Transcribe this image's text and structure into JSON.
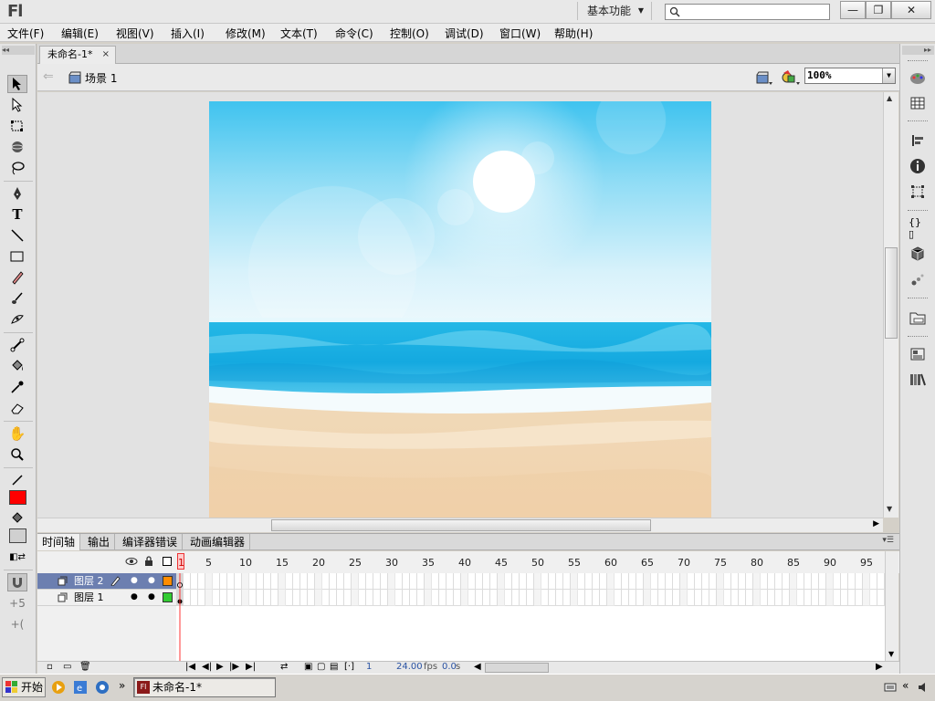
{
  "app": {
    "logo_text": "Fl",
    "workspace": "基本功能",
    "search_placeholder": "",
    "window_buttons": {
      "minimize": "—",
      "restore": "❐",
      "close": "✕"
    }
  },
  "menu": [
    "文件(F)",
    "编辑(E)",
    "视图(V)",
    "插入(I)",
    "修改(M)",
    "文本(T)",
    "命令(C)",
    "控制(O)",
    "调试(D)",
    "窗口(W)",
    "帮助(H)"
  ],
  "document": {
    "tab_title": "未命名-1*",
    "tab_close": "×",
    "scene_label": "场景 1",
    "zoom": "100%"
  },
  "colors": {
    "stroke_color": "#000000",
    "fill_color": "#ff0000",
    "layer2_color": "#ff8c00",
    "layer1_color": "#33cc33",
    "selected_layer_bg": "#6c7fb0",
    "playhead": "#ff3333"
  },
  "timeline": {
    "tabs": [
      "时间轴",
      "输出",
      "编译器错误",
      "动画编辑器"
    ],
    "frame_numbers": [
      "1",
      "5",
      "10",
      "15",
      "20",
      "25",
      "30",
      "35",
      "40",
      "45",
      "50",
      "55",
      "60",
      "65",
      "70",
      "75",
      "80",
      "85",
      "90",
      "95"
    ],
    "layers": [
      {
        "name": "图层 2",
        "selected": true
      },
      {
        "name": "图层 1",
        "selected": false
      }
    ],
    "current_frame": "1",
    "fps": "24.00",
    "fps_unit": "fps",
    "time": "0.0",
    "time_unit": "s"
  },
  "taskbar": {
    "start_label": "开始",
    "flash_task_label": "未命名-1*",
    "chevron": "»",
    "tray_chevron": "«"
  },
  "icons": {
    "tools": [
      "selection-tool-icon",
      "subselection-tool-icon",
      "free-transform-tool-icon",
      "3d-rotation-tool-icon",
      "lasso-tool-icon",
      "pen-tool-icon",
      "text-tool-icon",
      "line-tool-icon",
      "rectangle-tool-icon",
      "pencil-tool-icon",
      "brush-tool-icon",
      "deco-tool-icon",
      "bone-tool-icon",
      "paint-bucket-tool-icon",
      "eyedropper-tool-icon",
      "eraser-tool-icon",
      "hand-tool-icon",
      "zoom-tool-icon"
    ],
    "right_panel": [
      "color-panel-icon",
      "swatches-panel-icon",
      "align-panel-icon",
      "info-panel-icon",
      "transform-panel-icon",
      "code-snippets-icon",
      "components-icon",
      "motion-presets-icon",
      "project-panel-icon",
      "library-icon",
      "properties-icon"
    ]
  }
}
